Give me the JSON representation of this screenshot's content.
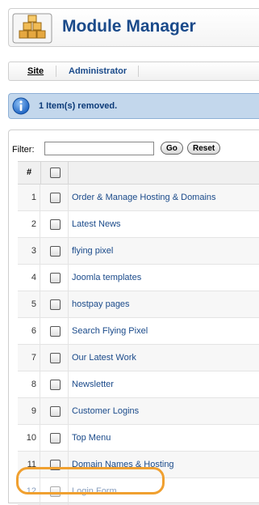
{
  "header": {
    "title": "Module Manager",
    "icon": "module-cubes-icon"
  },
  "submenu": {
    "tabs": [
      {
        "label": "Site",
        "active": true
      },
      {
        "label": "Administrator",
        "active": false
      }
    ]
  },
  "message": {
    "text": "1 Item(s) removed.",
    "icon": "info-icon"
  },
  "filter": {
    "label": "Filter:",
    "value": "",
    "go_label": "Go",
    "reset_label": "Reset"
  },
  "table": {
    "columns": [
      "#",
      ""
    ],
    "rows": [
      {
        "num": "1",
        "name": "Order & Manage Hosting & Domains"
      },
      {
        "num": "2",
        "name": "Latest News"
      },
      {
        "num": "3",
        "name": "flying pixel"
      },
      {
        "num": "4",
        "name": "Joomla templates"
      },
      {
        "num": "5",
        "name": "hostpay pages"
      },
      {
        "num": "6",
        "name": "Search Flying Pixel"
      },
      {
        "num": "7",
        "name": "Our Latest Work"
      },
      {
        "num": "8",
        "name": "Newsletter"
      },
      {
        "num": "9",
        "name": "Customer Logins"
      },
      {
        "num": "10",
        "name": "Top Menu"
      },
      {
        "num": "11",
        "name": "Domain Names & Hosting"
      },
      {
        "num": "12",
        "name": "Login Form"
      }
    ]
  },
  "colors": {
    "accent": "#1a4a8a",
    "message_bg": "#c3d7ec",
    "highlight": "#f0a030"
  }
}
